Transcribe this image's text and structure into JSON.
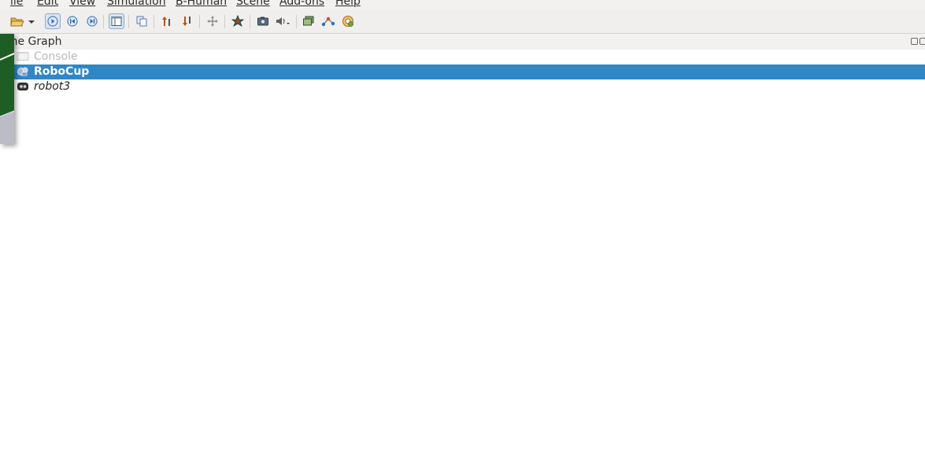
{
  "menubar": {
    "items": [
      {
        "id": "file",
        "label": "ile"
      },
      {
        "id": "edit",
        "label": "Edit"
      },
      {
        "id": "view",
        "label": "View"
      },
      {
        "id": "simulation",
        "label": "Simulation"
      },
      {
        "id": "bhuman",
        "label": "B-Human"
      },
      {
        "id": "scene",
        "label": "Scene"
      },
      {
        "id": "addons",
        "label": "Add-ons"
      },
      {
        "id": "help",
        "label": "Help"
      }
    ]
  },
  "toolbar": {
    "buttons": [
      {
        "id": "open",
        "icon": "folder-open-icon"
      },
      {
        "id": "start",
        "icon": "play-icon",
        "active": true
      },
      {
        "id": "reset",
        "icon": "skip-back-icon"
      },
      {
        "id": "step",
        "icon": "step-forward-icon"
      },
      {
        "id": "layout",
        "icon": "layout-panel-icon",
        "active": true
      },
      {
        "id": "copy",
        "icon": "copy-icon"
      },
      {
        "id": "move-up",
        "icon": "arrow-up-icon"
      },
      {
        "id": "move-down",
        "icon": "arrow-down-icon"
      },
      {
        "id": "drag",
        "icon": "move-cross-icon"
      },
      {
        "id": "physics",
        "icon": "physics-star-icon"
      },
      {
        "id": "camera",
        "icon": "camera-icon"
      },
      {
        "id": "sound",
        "icon": "speaker-icon"
      },
      {
        "id": "window",
        "icon": "window-stack-icon"
      },
      {
        "id": "plot",
        "icon": "graph-nodes-icon"
      },
      {
        "id": "update",
        "icon": "refresh-gear-icon"
      }
    ]
  },
  "dock": {
    "title": "ene Graph"
  },
  "tree": {
    "items": [
      {
        "id": "console",
        "label": "Console",
        "state": "disabled",
        "icon": "console-icon"
      },
      {
        "id": "robocup",
        "label": "RoboCup",
        "state": "selected",
        "icon": "scene-icon"
      },
      {
        "id": "robot3",
        "label": "robot3",
        "state": "italic",
        "icon": "robot-icon"
      }
    ]
  },
  "colors": {
    "selection": "#2f87c8",
    "field_green": "#1c5a22"
  }
}
